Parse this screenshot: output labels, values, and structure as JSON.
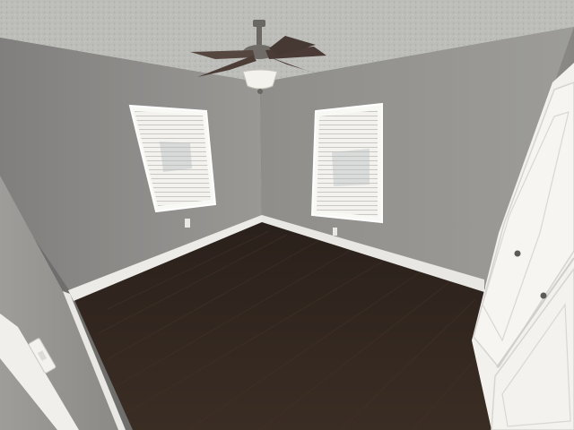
{
  "scene": {
    "kind": "photo",
    "subject": "empty-bedroom-interior",
    "colors": {
      "ceiling": "#b9b9b6",
      "wall_left": "#8c8b8a",
      "wall_back": "#95948f",
      "wall_right": "#8e8d89",
      "floor": "#2c211b",
      "floor_grain": "#3d2f26",
      "baseboard": "#ecebe7",
      "door": "#f2f1ee",
      "blinds": "#f4f3ef",
      "fan_metal": "#6b6762",
      "fan_blade": "#4a3b36"
    },
    "objects": [
      "ceiling-fan",
      "window-left",
      "window-right",
      "closet-doors",
      "hardwood-floor",
      "wall-outlet",
      "light-switch"
    ]
  }
}
